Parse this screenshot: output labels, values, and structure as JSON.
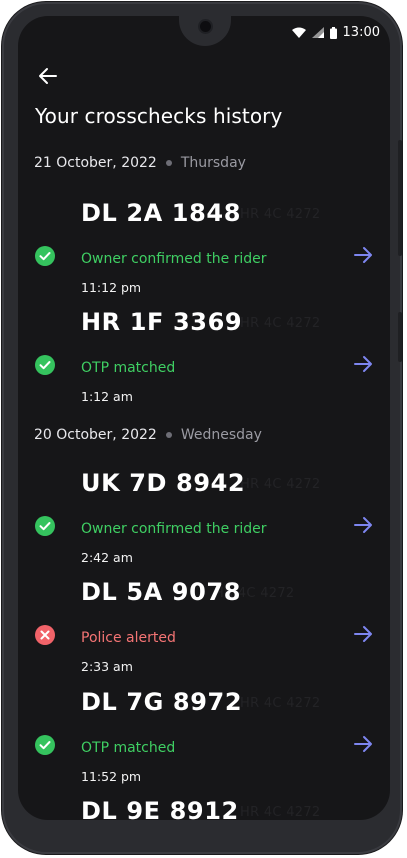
{
  "status_bar": {
    "time": "13:00"
  },
  "header": {
    "title": "Your crosschecks history"
  },
  "groups": [
    {
      "date": "21 October, 2022",
      "weekday": "Thursday",
      "items": [
        {
          "plate": "DL 2A 1848",
          "ghost": "HR 4C 4272",
          "result": "Owner confirmed the rider",
          "result_type": "ok",
          "time": "11:12 pm"
        },
        {
          "plate": "HR 1F 3369",
          "ghost": "HR 4C 4272",
          "result": "OTP matched",
          "result_type": "ok",
          "time": "1:12 am"
        }
      ]
    },
    {
      "date": "20 October, 2022",
      "weekday": "Wednesday",
      "items": [
        {
          "plate": "UK 7D 8942",
          "ghost": "HR 4C 4272",
          "result": "Owner confirmed the rider",
          "result_type": "ok",
          "time": "2:42 am"
        },
        {
          "plate": "DL 5A 9078",
          "ghost": "HR 4C 4272",
          "result": "Police alerted",
          "result_type": "bad",
          "time": "2:33 am"
        },
        {
          "plate": "DL 7G 8972",
          "ghost": "HR 4C 4272",
          "result": "OTP matched",
          "result_type": "ok",
          "time": "11:52 pm"
        },
        {
          "plate": "DL 9E 8912",
          "ghost": "HR 4C 4272",
          "result": "",
          "result_type": "ok",
          "time": ""
        }
      ]
    }
  ],
  "colors": {
    "ok": "#35c35e",
    "bad": "#f16369",
    "arrow": "#7e86f0",
    "background": "#161618"
  },
  "icons": {
    "back": "arrow-left-icon",
    "ok": "check-circle-icon",
    "bad": "x-circle-icon",
    "open": "arrow-right-icon"
  }
}
